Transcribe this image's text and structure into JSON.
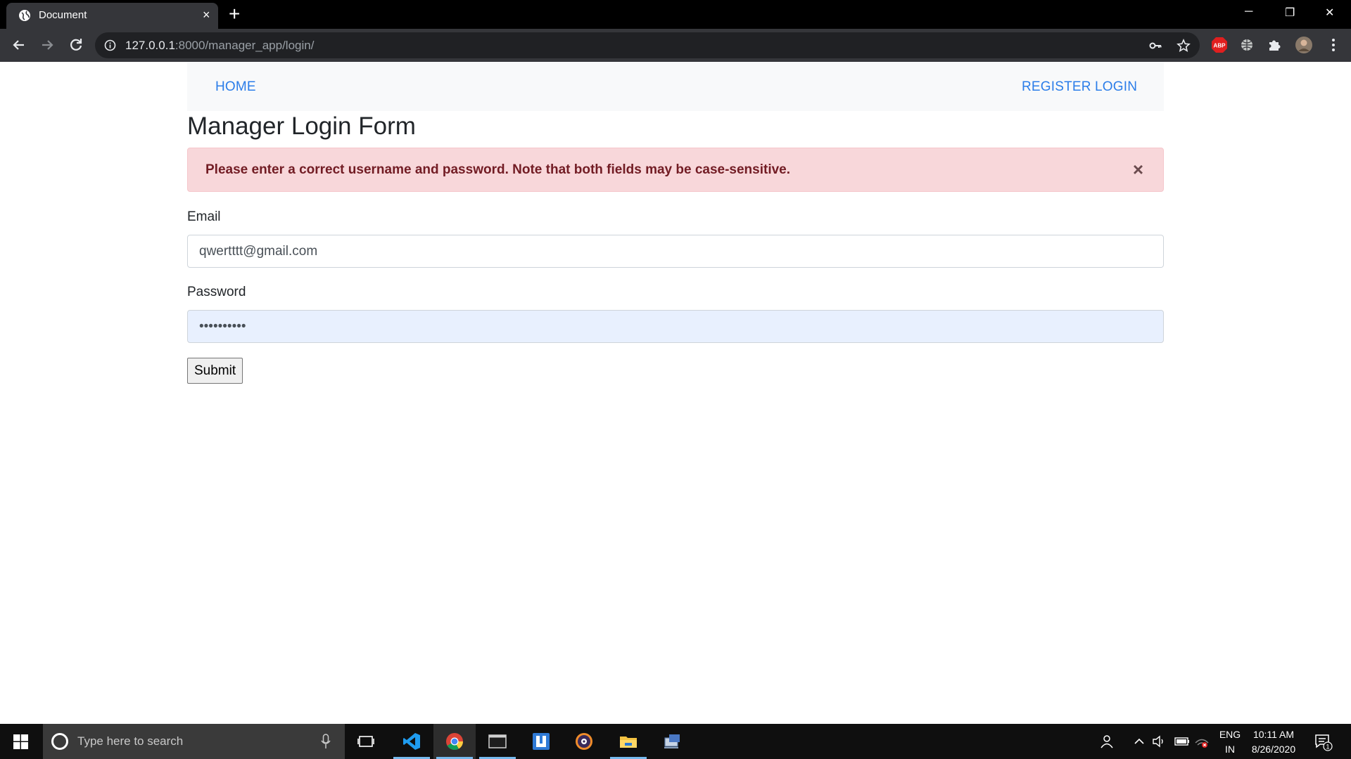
{
  "browser": {
    "tab_title": "Document",
    "tab_close": "×",
    "new_tab": "+",
    "url_host": "127.0.0.1",
    "url_rest": ":8000/manager_app/login/",
    "window_minimize": "─",
    "window_restore": "❐",
    "window_close": "✕"
  },
  "nav": {
    "home": "HOME",
    "register": "REGISTER",
    "login": "LOGIN"
  },
  "page": {
    "heading": "Manager Login Form",
    "alert_message": "Please enter a correct username and password. Note that both fields may be case-sensitive.",
    "alert_close": "×",
    "email_label": "Email",
    "email_value": "qwertttt@gmail.com",
    "password_label": "Password",
    "password_value": "••••••••••",
    "submit_label": "Submit"
  },
  "taskbar": {
    "search_placeholder": "Type here to search",
    "language_line1": "ENG",
    "language_line2": "IN",
    "time": "10:11 AM",
    "date": "8/26/2020",
    "notification_count": "1"
  },
  "colors": {
    "link": "#2b7de9",
    "alert_bg": "#f8d7da",
    "alert_text": "#721c24",
    "autofill_bg": "#e8f0fe"
  }
}
